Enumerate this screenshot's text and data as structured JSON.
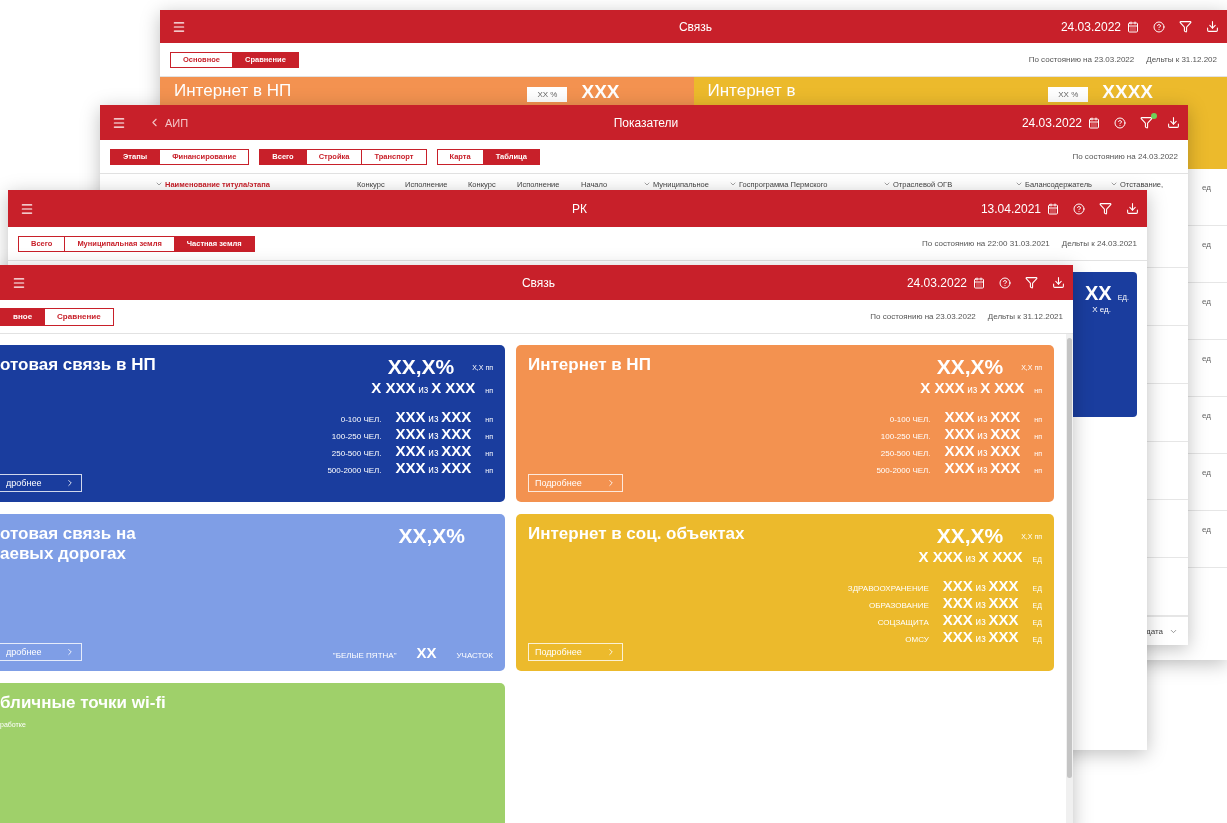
{
  "windows": [
    {
      "kind": "summary_back",
      "title": "Связь",
      "date": "24.03.2022",
      "filter_badge": false,
      "tab_groups": [
        {
          "tabs": [
            {
              "label": "Основное",
              "selected": false
            },
            {
              "label": "Сравнение",
              "selected": true
            }
          ]
        }
      ],
      "status": [
        "По состоянию на 23.03.2022",
        "Дельты к 31.12.202"
      ],
      "cards": [
        {
          "title": "Интернет в НП",
          "color": "#f39250",
          "chip": "XX %",
          "value": "XXX"
        },
        {
          "title": "Интернет в",
          "color": "#ecba2c",
          "chip": "XX %",
          "value": "XXXX"
        }
      ],
      "units": [
        "ед",
        "ед",
        "ед",
        "ед",
        "ед",
        "ед",
        "ед"
      ]
    },
    {
      "kind": "table",
      "back": "АИП",
      "title": "Показатели",
      "date": "24.03.2022",
      "filter_badge": true,
      "tab_groups": [
        {
          "tabs": [
            {
              "label": "Этапы",
              "selected": true
            },
            {
              "label": "Финансирование",
              "selected": false
            }
          ]
        },
        {
          "tabs": [
            {
              "label": "Всего",
              "selected": true
            },
            {
              "label": "Стройка",
              "selected": false
            },
            {
              "label": "Транспорт",
              "selected": false
            }
          ]
        },
        {
          "tabs": [
            {
              "label": "Карта",
              "selected": false
            },
            {
              "label": "Таблица",
              "selected": true
            }
          ]
        }
      ],
      "status": [
        "По состоянию на 24.03.2022"
      ],
      "columns": [
        {
          "label": "Наименование титула/этапа",
          "caret": true
        },
        {
          "label": "Конкурс",
          "caret": false
        },
        {
          "label": "Исполнение",
          "caret": false
        },
        {
          "label": "Конкурс",
          "caret": false
        },
        {
          "label": "Исполнение",
          "caret": false
        },
        {
          "label": "Начало",
          "caret": false
        },
        {
          "label": "Муниципальное",
          "caret": true
        },
        {
          "label": "Госпрограмма Пермского",
          "caret": true
        },
        {
          "label": "Отраслевой ОГВ",
          "caret": true
        },
        {
          "label": "Балансодержатель",
          "caret": true
        },
        {
          "label": "Отставание,",
          "caret": true
        }
      ],
      "footer": "дата"
    },
    {
      "kind": "land",
      "title": "РК",
      "date": "13.04.2021",
      "filter_badge": false,
      "tab_groups": [
        {
          "tabs": [
            {
              "label": "Всего",
              "selected": false
            },
            {
              "label": "Муниципальная земля",
              "selected": false
            },
            {
              "label": "Частная земля",
              "selected": true
            }
          ]
        }
      ],
      "status": [
        "По состоянию на 22:00 31.03.2021",
        "Дельты к 24.03.2021"
      ],
      "cards": [
        {
          "color": "#1a3d9e",
          "value": "XX",
          "unit": "ЕД.",
          "note": "X ед."
        }
      ]
    },
    {
      "kind": "summary",
      "title": "Связь",
      "date": "24.03.2022",
      "filter_badge": false,
      "tab_groups": [
        {
          "tabs": [
            {
              "label": "вное",
              "selected": true
            },
            {
              "label": "Сравнение",
              "selected": false
            }
          ]
        }
      ],
      "status": [
        "По состоянию на 23.03.2022",
        "Дельты к 31.12.2021"
      ],
      "cards": [
        {
          "title": [
            "отовая связь в НП"
          ],
          "color": "#1a3d9e",
          "percent": "XX,X%",
          "delta": "X,X пп",
          "total": "**X XXX** из **X XXX**",
          "total_unit": "нп",
          "rows": [
            {
              "label": "0-100 ЧЕЛ.",
              "value": "**XXX** из **XXX**",
              "unit": "нп"
            },
            {
              "label": "100-250 ЧЕЛ.",
              "value": "**XXX** из **XXX**",
              "unit": "нп"
            },
            {
              "label": "250-500 ЧЕЛ.",
              "value": "**XXX** из **XXX**",
              "unit": "нп"
            },
            {
              "label": "500-2000 ЧЕЛ.",
              "value": "**XXX** из **XXX**",
              "unit": "нп"
            }
          ],
          "button": "дробнее"
        },
        {
          "title": [
            "Интернет в НП"
          ],
          "color": "#f39250",
          "percent": "XX,X%",
          "delta": "X,X пп",
          "total": "**X XXX** из **X XXX**",
          "total_unit": "нп",
          "rows": [
            {
              "label": "0-100 ЧЕЛ.",
              "value": "**XXX** из **XXX**",
              "unit": "нп"
            },
            {
              "label": "100-250 ЧЕЛ.",
              "value": "**XXX** из **XXX**",
              "unit": "нп"
            },
            {
              "label": "250-500 ЧЕЛ.",
              "value": "**XXX** из **XXX**",
              "unit": "нп"
            },
            {
              "label": "500-2000 ЧЕЛ.",
              "value": "**XXX** из **XXX**",
              "unit": "нп"
            }
          ],
          "button": "Подробнее"
        },
        {
          "title": [
            "отовая связь на",
            "аевых дорогах"
          ],
          "color": "#7f9ee6",
          "percent": "XX,X%",
          "stat": {
            "label": "\"БЕЛЫЕ ПЯТНА\"",
            "value": "XX",
            "unit": "УЧАСТОК"
          },
          "button": "дробнее"
        },
        {
          "title": [
            "Интернет в соц. объектах"
          ],
          "color": "#ecba2c",
          "percent": "XX,X%",
          "delta": "X,X пп",
          "total": "**X XXX** из **X XXX**",
          "total_unit": "ЕД",
          "rows": [
            {
              "label": "ЗДРАВООХРАНЕНИЕ",
              "value": "**XXX** из **XXX**",
              "unit": "ЕД"
            },
            {
              "label": "ОБРАЗОВАНИЕ",
              "value": "**XXX** из **XXX**",
              "unit": "ЕД"
            },
            {
              "label": "СОЦЗАЩИТА",
              "value": "**XXX** из **XXX**",
              "unit": "ЕД"
            },
            {
              "label": "ОМСУ",
              "value": "**XXX** из **XXX**",
              "unit": "ЕД"
            }
          ],
          "button": "Подробнее"
        },
        {
          "title": [
            "бличные точки wi-fi"
          ],
          "color": "#9fd06a",
          "note": "работке"
        }
      ]
    }
  ]
}
